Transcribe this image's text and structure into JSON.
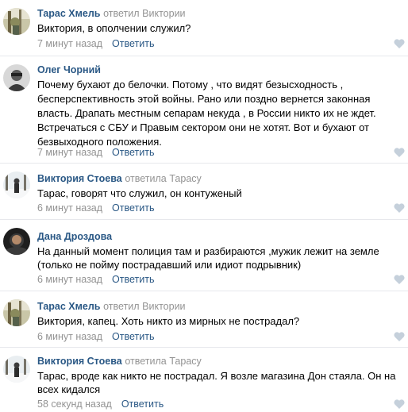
{
  "accent_color": "#2a5885",
  "muted_color": "#939393",
  "heart_color": "#c5d0db",
  "comments": [
    {
      "author": "Тарас Хмель",
      "reply_word": "ответил",
      "reply_to": "Виктории",
      "lines": [
        "Виктория, в ополчении служил?"
      ],
      "time": "7 минут назад",
      "reply_label": "Ответить",
      "avatar": "avatar-photo-forest"
    },
    {
      "author": "Олег Чорний",
      "reply_word": "",
      "reply_to": "",
      "lines": [
        "Почему бухают до белочки. Потому , что видят безысходность ,",
        "бесперспективность этой войны. Рано или поздно вернется законная",
        "власть. Драпать местным сепарам некуда , в России никто их не ждет.",
        "Встречаться с СБУ и Правым сектором они не хотят. Вот и бухают от",
        "безвыходного положения."
      ],
      "time": "7 минут назад",
      "reply_label": "Ответить",
      "avatar": "avatar-photo-portrait"
    },
    {
      "author": "Виктория Стоева",
      "reply_word": "ответила",
      "reply_to": "Тарасу",
      "lines": [
        "Тарас, говорят что служил, он контуженый"
      ],
      "time": "6 минут назад",
      "reply_label": "Ответить",
      "avatar": "avatar-photo-snow"
    },
    {
      "author": "Дана Дроздова",
      "reply_word": "",
      "reply_to": "",
      "lines": [
        "На данный момент полиция там и разбираются ,мужик лежит на земле",
        "(только не пойму пострадавший или идиот подрывник)"
      ],
      "time": "6 минут назад",
      "reply_label": "Ответить",
      "avatar": "avatar-photo-dark"
    },
    {
      "author": "Тарас Хмель",
      "reply_word": "ответил",
      "reply_to": "Виктории",
      "lines": [
        "Виктория, капец. Хоть никто из мирных не пострадал?"
      ],
      "time": "6 минут назад",
      "reply_label": "Ответить",
      "avatar": "avatar-photo-forest"
    },
    {
      "author": "Виктория Стоева",
      "reply_word": "ответила",
      "reply_to": "Тарасу",
      "lines": [
        "Тарас, вроде как никто не пострадал. Я возле магазина Дон стаяла. Он на",
        "всех кидался"
      ],
      "time": "58 секунд назад",
      "reply_label": "Ответить",
      "avatar": "avatar-photo-snow"
    }
  ]
}
